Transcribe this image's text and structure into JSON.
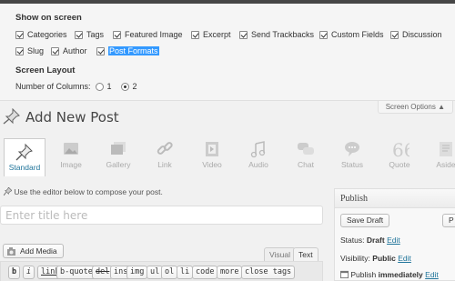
{
  "screen_options": {
    "show_heading": "Show on screen",
    "checkboxes": [
      {
        "label": "Categories",
        "checked": true
      },
      {
        "label": "Tags",
        "checked": true
      },
      {
        "label": "Featured Image",
        "checked": true
      },
      {
        "label": "Excerpt",
        "checked": true
      },
      {
        "label": "Send Trackbacks",
        "checked": true
      },
      {
        "label": "Custom Fields",
        "checked": true
      },
      {
        "label": "Discussion",
        "checked": true
      },
      {
        "label": "Slug",
        "checked": true
      },
      {
        "label": "Author",
        "checked": true
      },
      {
        "label": "Post Formats",
        "checked": true
      }
    ],
    "layout_heading": "Screen Layout",
    "columns_label": "Number of Columns:",
    "column_options": [
      {
        "label": "1",
        "selected": false
      },
      {
        "label": "2",
        "selected": true
      }
    ],
    "tab_label": "Screen Options ▲"
  },
  "page": {
    "title": "Add New Post"
  },
  "formats": [
    {
      "label": "Standard",
      "icon": "pushpin-icon",
      "active": true
    },
    {
      "label": "Image",
      "icon": "image-icon",
      "active": false
    },
    {
      "label": "Gallery",
      "icon": "gallery-icon",
      "active": false
    },
    {
      "label": "Link",
      "icon": "chain-link-icon",
      "active": false
    },
    {
      "label": "Video",
      "icon": "film-icon",
      "active": false
    },
    {
      "label": "Audio",
      "icon": "music-note-icon",
      "active": false
    },
    {
      "label": "Chat",
      "icon": "chat-bubbles-icon",
      "active": false
    },
    {
      "label": "Status",
      "icon": "status-bubble-icon",
      "active": false
    },
    {
      "label": "Quote",
      "icon": "quote-icon",
      "active": false
    },
    {
      "label": "Aside",
      "icon": "aside-icon",
      "active": false
    }
  ],
  "editor": {
    "prompt": "Use the editor below to compose your post.",
    "title_placeholder": "Enter title here",
    "add_media": "Add Media",
    "tabs": [
      "Visual",
      "Text"
    ],
    "active_tab": "Text",
    "quicktags": [
      "b",
      "i",
      "link",
      "b-quote",
      "del",
      "ins",
      "img",
      "ul",
      "ol",
      "li",
      "code",
      "more",
      "close tags"
    ]
  },
  "publish": {
    "heading": "Publish",
    "save_draft": "Save Draft",
    "preview_partial": "P",
    "status_label": "Status:",
    "status_value": "Draft",
    "visibility_label": "Visibility:",
    "visibility_value": "Public",
    "publish_label": "Publish",
    "publish_value": "immediately",
    "edit": "Edit"
  },
  "colors": {
    "accent": "#21759b",
    "highlight": "#3399ff"
  }
}
